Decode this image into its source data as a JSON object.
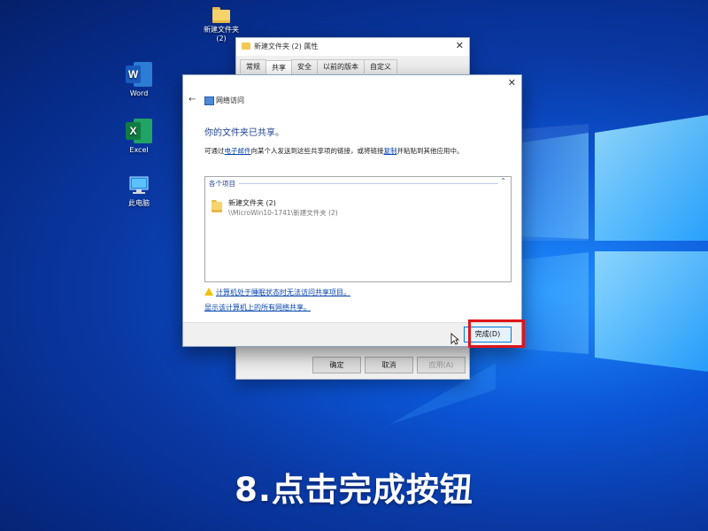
{
  "desktop": {
    "icons": [
      {
        "label_line1": "新建文件夹",
        "label_line2": "(2)",
        "icon": "folder-icon"
      },
      {
        "label": "Word",
        "icon": "word-icon"
      },
      {
        "label": "Excel",
        "icon": "excel-icon"
      },
      {
        "label": "此电脑",
        "icon": "this-pc-icon"
      }
    ]
  },
  "properties_window": {
    "title": "新建文件夹 (2) 属性",
    "tabs": [
      "常规",
      "共享",
      "安全",
      "以前的版本",
      "自定义"
    ],
    "active_tab": "共享",
    "buttons": {
      "ok": "确定",
      "cancel": "取消",
      "apply": "应用(A)"
    }
  },
  "wizard": {
    "nav_title": "网络访问",
    "heading": "你的文件夹已共享。",
    "desc": {
      "part1": "可通过",
      "link1": "电子邮件",
      "part2": "向某个人发送到这些共享项的链接，或将链接",
      "link2": "复制",
      "part3": "并粘贴到其他应用中。"
    },
    "group_label": "各个项目",
    "item": {
      "name": "新建文件夹 (2)",
      "path": "\\\\MicroWin10-1741\\新建文件夹 (2)"
    },
    "warning_link": "计算机处于睡眠状态时无法访问共享项目。",
    "show_all_link": "显示该计算机上的所有网络共享。",
    "finish_button": "完成(D)"
  },
  "caption": "8.点击完成按钮",
  "colors": {
    "highlight": "#e0141b",
    "heading": "#1c3f94",
    "link": "#0645ad"
  }
}
